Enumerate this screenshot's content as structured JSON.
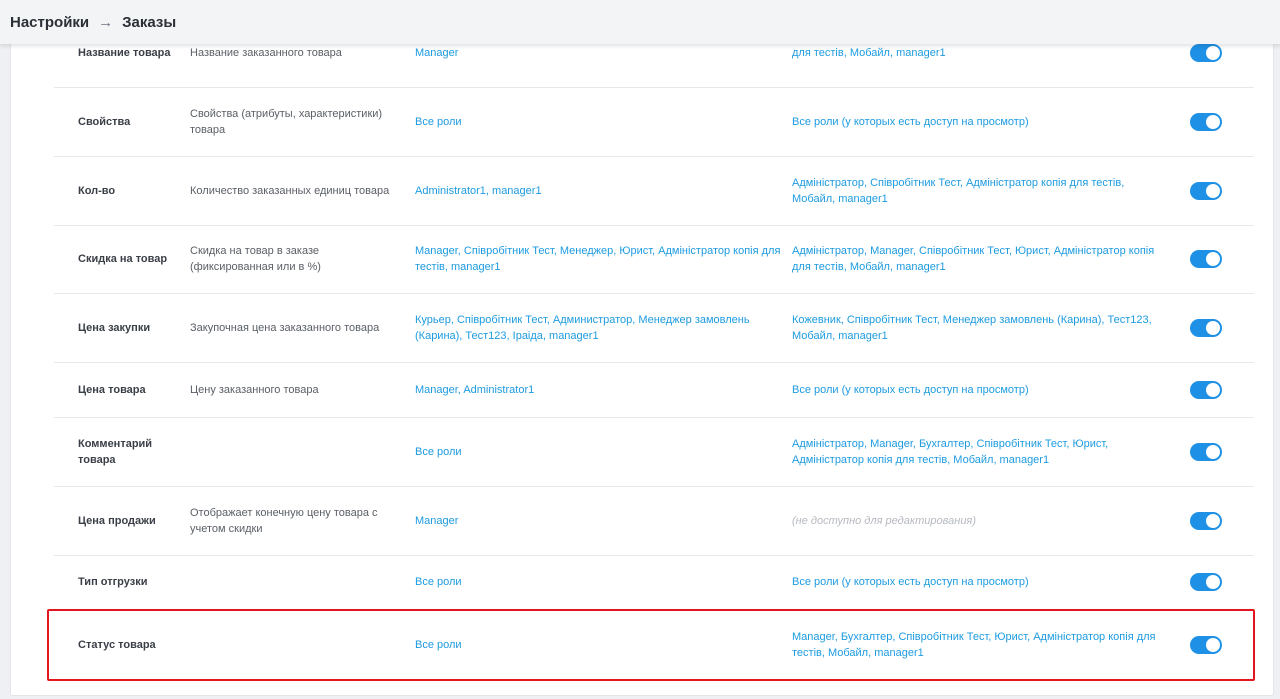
{
  "breadcrumb": {
    "root": "Настройки",
    "separator": "→",
    "current": "Заказы"
  },
  "colors": {
    "accent": "#1d9be0",
    "toggle_on": "#1e90e6",
    "highlight_border": "#e3161f"
  },
  "rows": [
    {
      "name": "Название товара",
      "description": "Название заказанного товара",
      "edit_roles": "Manager",
      "view_roles": "для тестів, Мобайл, manager1",
      "view_disabled": false,
      "enabled": true
    },
    {
      "name": "Свойства",
      "description": "Свойства (атрибуты, характеристики) товара",
      "edit_roles": "Все роли",
      "view_roles": "Все роли (у которых есть доступ на просмотр)",
      "view_disabled": false,
      "enabled": true
    },
    {
      "name": "Кол-во",
      "description": "Количество заказанных единиц товара",
      "edit_roles": "Administrator1, manager1",
      "view_roles": "Адміністратор, Співробітник Тест, Адміністратор копія для тестів, Мобайл, manager1",
      "view_disabled": false,
      "enabled": true
    },
    {
      "name": "Скидка на товар",
      "description": "Скидка на товар в заказе (фиксированная или в %)",
      "edit_roles": "Manager, Співробітник Тест, Менеджер, Юрист, Адміністратор копія для тестів, manager1",
      "view_roles": "Адміністратор, Manager, Співробітник Тест, Юрист, Адміністратор копія для тестів, Мобайл, manager1",
      "view_disabled": false,
      "enabled": true
    },
    {
      "name": "Цена закупки",
      "description": "Закупочная цена заказанного товара",
      "edit_roles": "Курьер, Співробітник Тест, Администратор, Менеджер замовлень (Карина), Тест123, Іраіда, manager1",
      "view_roles": "Кожевник, Співробітник Тест, Менеджер замовлень (Карина), Тест123, Мобайл, manager1",
      "view_disabled": false,
      "enabled": true
    },
    {
      "name": "Цена товара",
      "description": "Цену заказанного товара",
      "edit_roles": "Manager, Administrator1",
      "view_roles": "Все роли (у которых есть доступ на просмотр)",
      "view_disabled": false,
      "enabled": true
    },
    {
      "name": "Комментарий товара",
      "description": "",
      "edit_roles": "Все роли",
      "view_roles": "Адміністратор, Manager, Бухгалтер, Співробітник Тест, Юрист, Адміністратор копія для тестів, Мобайл, manager1",
      "view_disabled": false,
      "enabled": true
    },
    {
      "name": "Цена продажи",
      "description": "Отображает конечную цену товара с учетом скидки",
      "edit_roles": "Manager",
      "view_roles": "(не доступно для редактирования)",
      "view_disabled": true,
      "enabled": true
    },
    {
      "name": "Тип отгрузки",
      "description": "",
      "edit_roles": "Все роли",
      "view_roles": "Все роли (у которых есть доступ на просмотр)",
      "view_disabled": false,
      "enabled": true
    },
    {
      "name": "Статус товара",
      "description": "",
      "edit_roles": "Все роли",
      "view_roles": "Manager, Бухгалтер, Співробітник Тест, Юрист, Адміністратор копія для тестів, Мобайл, manager1",
      "view_disabled": false,
      "enabled": true,
      "highlighted": true
    }
  ]
}
